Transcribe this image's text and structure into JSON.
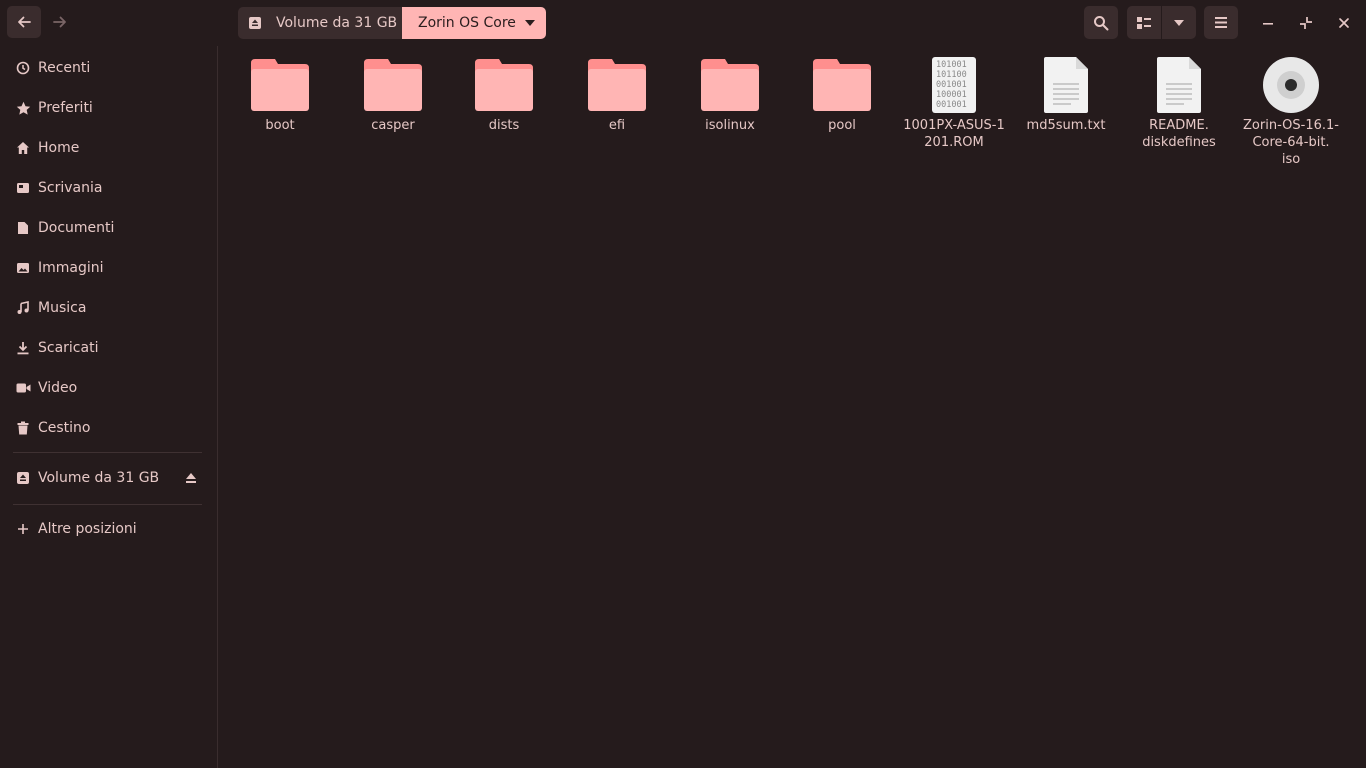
{
  "header": {
    "breadcrumb_root": "Volume da 31 GB",
    "breadcrumb_current": "Zorin OS Core"
  },
  "sidebar": {
    "places": [
      {
        "label": "Recenti",
        "icon": "clock-icon"
      },
      {
        "label": "Preferiti",
        "icon": "star-icon"
      },
      {
        "label": "Home",
        "icon": "home-icon"
      },
      {
        "label": "Scrivania",
        "icon": "desktop-icon"
      },
      {
        "label": "Documenti",
        "icon": "document-icon"
      },
      {
        "label": "Immagini",
        "icon": "image-icon"
      },
      {
        "label": "Musica",
        "icon": "music-icon"
      },
      {
        "label": "Scaricati",
        "icon": "download-icon"
      },
      {
        "label": "Video",
        "icon": "video-icon"
      },
      {
        "label": "Cestino",
        "icon": "trash-icon"
      }
    ],
    "device": {
      "label": "Volume da 31 GB",
      "icon": "drive-icon"
    },
    "other": {
      "label": "Altre posizioni",
      "icon": "plus-icon"
    }
  },
  "files": [
    {
      "name": "boot",
      "kind": "folder"
    },
    {
      "name": "casper",
      "kind": "folder"
    },
    {
      "name": "dists",
      "kind": "folder"
    },
    {
      "name": "efi",
      "kind": "folder"
    },
    {
      "name": "isolinux",
      "kind": "folder"
    },
    {
      "name": "pool",
      "kind": "folder"
    },
    {
      "name": "1001PX-ASUS-1201.ROM",
      "kind": "binary"
    },
    {
      "name": "md5sum.txt",
      "kind": "text"
    },
    {
      "name": "README.\ndiskdefines",
      "kind": "text"
    },
    {
      "name": "Zorin-OS-16.1-Core-64-bit.\niso",
      "kind": "disc"
    }
  ],
  "colors": {
    "background": "#251b1c",
    "accent": "#ffb5b4",
    "folder": "#ffb5b4",
    "text": "#e6c8c6"
  }
}
